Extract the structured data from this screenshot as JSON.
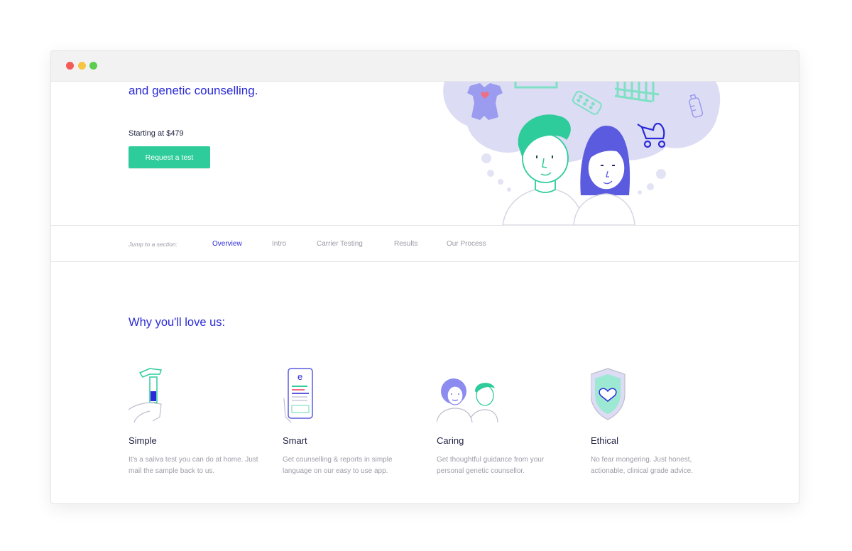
{
  "hero": {
    "title_line": "and genetic counselling.",
    "price_text": "Starting at $479",
    "cta_label": "Request a test"
  },
  "jump_nav": {
    "label": "Jump to a section:",
    "links": [
      "Overview",
      "Intro",
      "Carrier Testing",
      "Results",
      "Our Process"
    ],
    "active": "Overview"
  },
  "why": {
    "title": "Why you'll love us:",
    "features": [
      {
        "title": "Simple",
        "desc": "It's a saliva test you can do at home. Just mail the sample back to us.",
        "icon": "saliva-tube-icon"
      },
      {
        "title": "Smart",
        "desc": "Get counselling & reports in simple language on our easy to use app.",
        "icon": "phone-app-icon"
      },
      {
        "title": "Caring",
        "desc": "Get thoughtful guidance from your personal genetic counsellor.",
        "icon": "counsellor-people-icon"
      },
      {
        "title": "Ethical",
        "desc": "No fear mongering. Just honest, actionable, clinical grade advice.",
        "icon": "shield-heart-icon"
      }
    ]
  },
  "colors": {
    "accent_blue": "#2a2ad8",
    "accent_green": "#2ecc9a",
    "text_dark": "#1c2040",
    "text_muted": "#9c9ca8",
    "lavender": "#dcdcf4"
  }
}
